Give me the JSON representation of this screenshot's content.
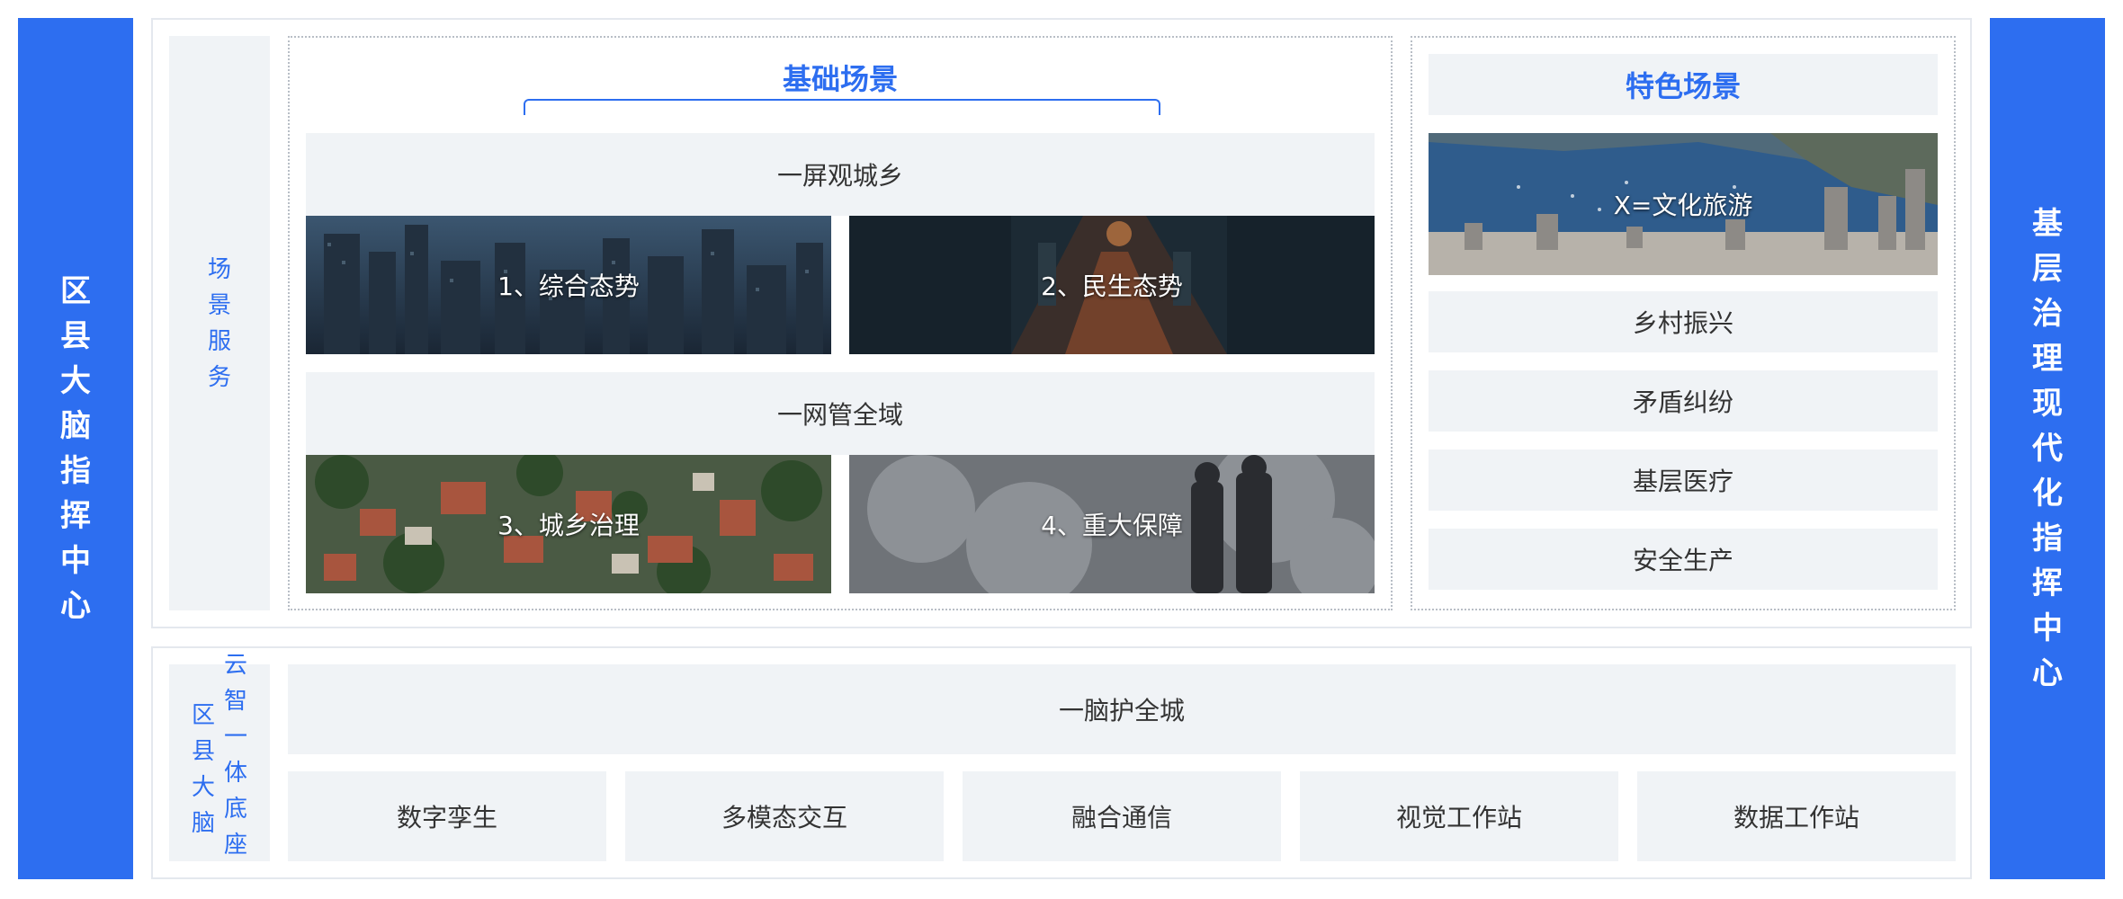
{
  "left_bar": {
    "chars": [
      "区",
      "县",
      "大",
      "脑",
      "指",
      "挥",
      "中",
      "心"
    ]
  },
  "right_bar": {
    "chars": [
      "基",
      "层",
      "治",
      "理",
      "现",
      "代",
      "化",
      "指",
      "挥",
      "中",
      "心"
    ]
  },
  "scene_service": {
    "chars": [
      "场",
      "景",
      "服",
      "务"
    ]
  },
  "basic_scenes": {
    "title": "基础场景",
    "groups": [
      {
        "title": "一屏观城乡",
        "tiles": [
          "1、综合态势",
          "2、民生态势"
        ]
      },
      {
        "title": "一网管全域",
        "tiles": [
          "3、城乡治理",
          "4、重大保障"
        ]
      }
    ]
  },
  "feature_scenes": {
    "title": "特色场景",
    "image_tile": "X=文化旅游",
    "items": [
      "乡村振兴",
      "矛盾纠纷",
      "基层医疗",
      "安全生产"
    ]
  },
  "base_platform": {
    "label_col1": [
      "区",
      "县",
      "大",
      "脑"
    ],
    "label_col2": [
      "云",
      "智",
      "一",
      "体",
      "底",
      "座"
    ],
    "title": "一脑护全城",
    "modules": [
      "数字孪生",
      "多模态交互",
      "融合通信",
      "视觉工作站",
      "数据工作站"
    ]
  },
  "colors": {
    "accent": "#2d6ef0",
    "tile_bg": "#f0f3f6",
    "border": "#e4e8ee"
  }
}
